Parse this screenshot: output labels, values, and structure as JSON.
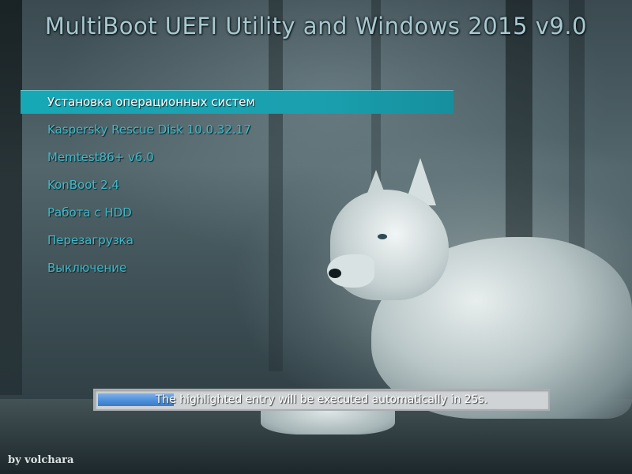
{
  "title": "MultiBoot UEFI Utility and Windows 2015 v9.0",
  "menu": {
    "selected_index": 0,
    "items": [
      {
        "label": "Установка операционных систем"
      },
      {
        "label": "Kaspersky Rescue Disk 10.0.32.17"
      },
      {
        "label": "Memtest86+ v6.0"
      },
      {
        "label": "KonBoot 2.4"
      },
      {
        "label": "Работа с HDD"
      },
      {
        "label": "Перезагрузка"
      },
      {
        "label": "Выключение"
      }
    ]
  },
  "timeout": {
    "message": "The highlighted entry will be executed automatically in 25s.",
    "progress": 0.17
  },
  "credit": "by volchara",
  "colors": {
    "accent": "#17a8b6",
    "menu_text": "#3fb9c8",
    "progress_fill": "#4a8dd9"
  }
}
